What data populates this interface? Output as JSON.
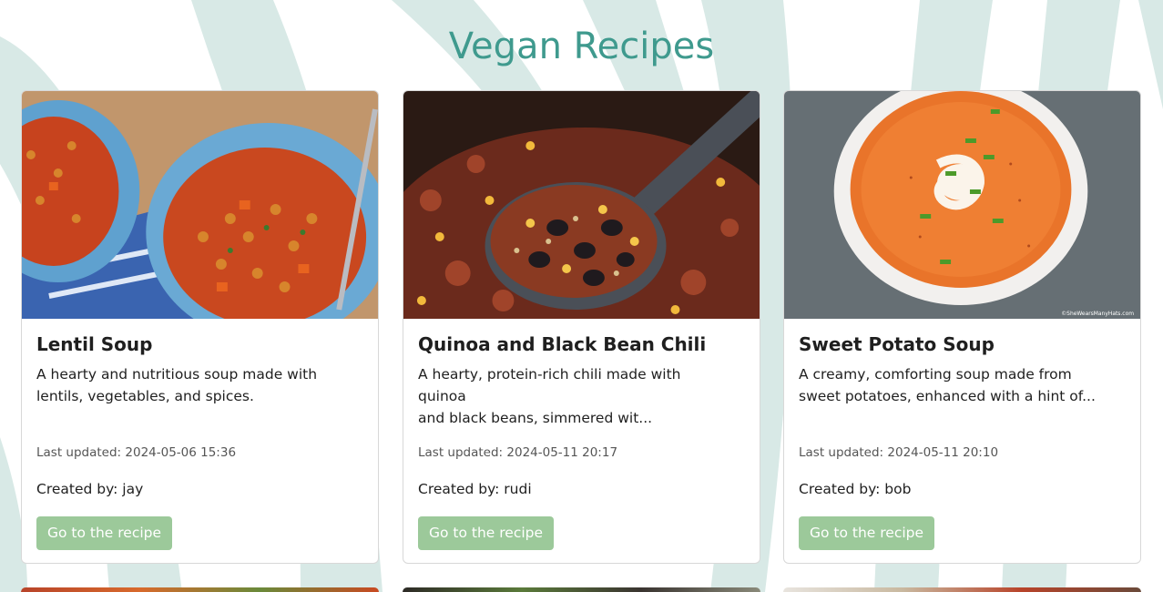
{
  "page": {
    "title": "Vegan Recipes"
  },
  "theme": {
    "title_color": "#3f9a8e",
    "background_wave_color": "#d8e9e6",
    "button_color": "#9cc99a"
  },
  "recipes": [
    {
      "title": "Lentil Soup",
      "description_line1": "A hearty and nutritious soup made with",
      "description_line2": "lentils, vegetables, and spices.",
      "last_updated": "Last updated: 2024-05-06 15:36",
      "created_by": "Created by: jay",
      "button_label": "Go to the recipe",
      "image": "lentil-soup-photo"
    },
    {
      "title": "Quinoa and Black Bean Chili",
      "description_line1": "A hearty, protein-rich chili made with quinoa",
      "description_line2": "and black beans, simmered wit...",
      "last_updated": "Last updated: 2024-05-11 20:17",
      "created_by": "Created by: rudi",
      "button_label": "Go to the recipe",
      "image": "quinoa-chili-photo"
    },
    {
      "title": "Sweet Potato Soup",
      "description_line1": "A creamy, comforting soup made from",
      "description_line2": "sweet potatoes, enhanced with a hint of...",
      "last_updated": "Last updated: 2024-05-11 20:10",
      "created_by": "Created by: bob",
      "button_label": "Go to the recipe",
      "image": "sweet-potato-soup-photo",
      "photo_watermark": "©SheWearsManyHats.com"
    }
  ]
}
